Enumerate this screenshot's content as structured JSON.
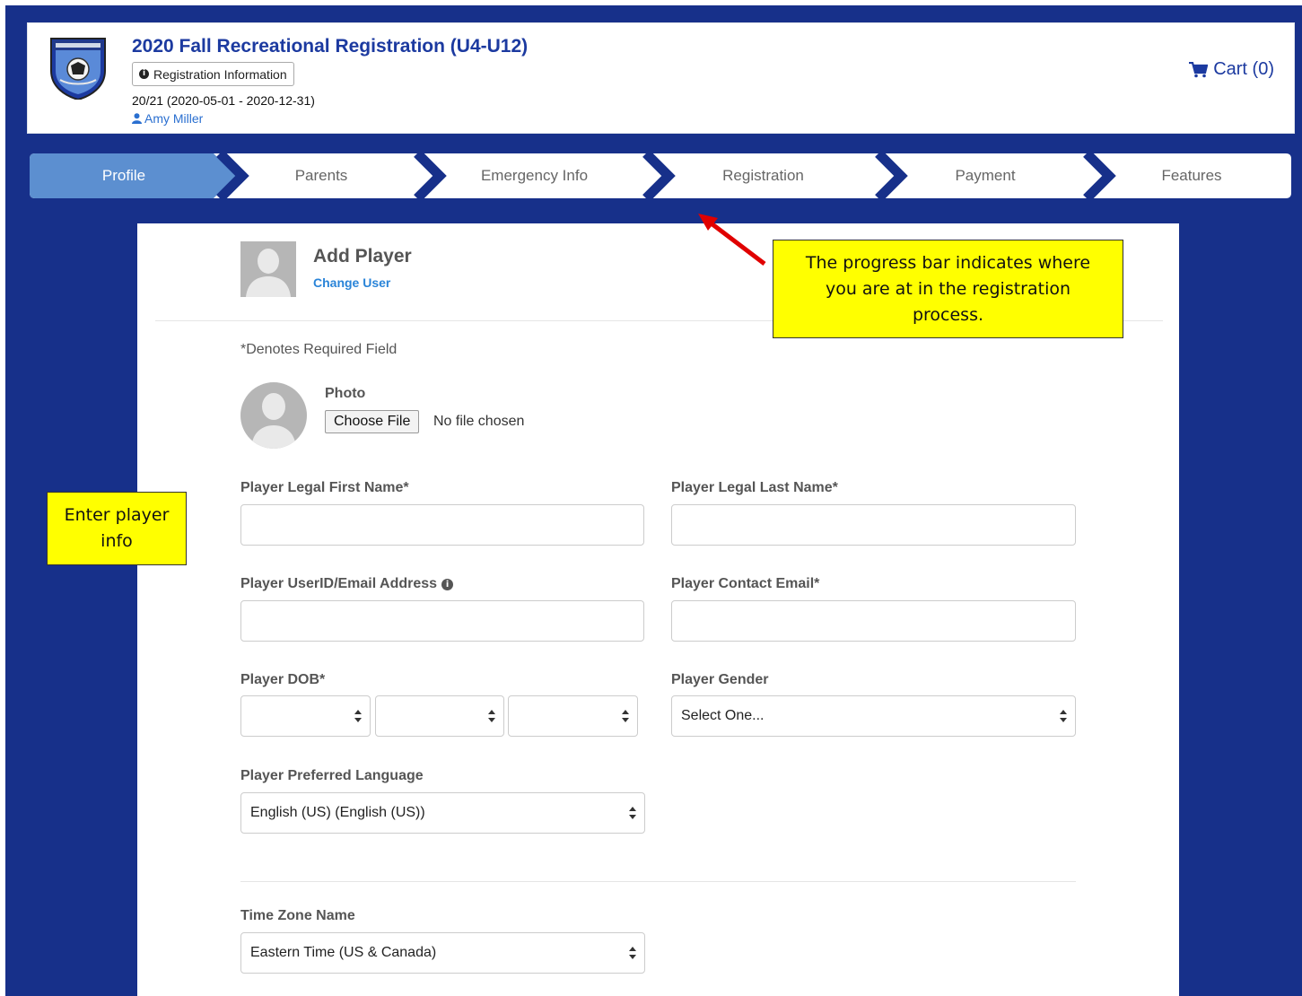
{
  "header": {
    "title": "2020 Fall Recreational Registration (U4-U12)",
    "info_button_label": "Registration Information",
    "season": "20/21 (2020-05-01 - 2020-12-31)",
    "user_name": "Amy Miller",
    "cart_label": "Cart (0)"
  },
  "steps": [
    {
      "label": "Profile",
      "active": true
    },
    {
      "label": "Parents",
      "active": false
    },
    {
      "label": "Emergency Info",
      "active": false
    },
    {
      "label": "Registration",
      "active": false
    },
    {
      "label": "Payment",
      "active": false
    },
    {
      "label": "Features",
      "active": false
    }
  ],
  "card": {
    "title": "Add Player",
    "change_user": "Change User",
    "required_note": "*Denotes Required Field",
    "photo_label": "Photo",
    "choose_file": "Choose File",
    "no_file": "No file chosen"
  },
  "form": {
    "first_name_label": "Player Legal First Name*",
    "first_name_value": "",
    "last_name_label": "Player Legal Last Name*",
    "last_name_value": "",
    "userid_label": "Player UserID/Email Address",
    "userid_value": "",
    "contact_email_label": "Player Contact Email*",
    "contact_email_value": "",
    "dob_label": "Player DOB*",
    "dob_month": "",
    "dob_day": "",
    "dob_year": "",
    "gender_label": "Player Gender",
    "gender_value": "Select One...",
    "language_label": "Player Preferred Language",
    "language_value": "English (US) (English (US))",
    "timezone_label": "Time Zone Name",
    "timezone_value": "Eastern Time (US & Canada)"
  },
  "callouts": {
    "progress_note": "The progress bar indicates where you are at in the registration process.",
    "player_note": "Enter player info"
  },
  "colors": {
    "frame_blue": "#17308a",
    "title_blue": "#1c3aa0",
    "active_step": "#5c8fd0",
    "link_blue": "#2a84d8",
    "callout_yellow": "#ffff00",
    "arrow_red": "#e00000"
  }
}
